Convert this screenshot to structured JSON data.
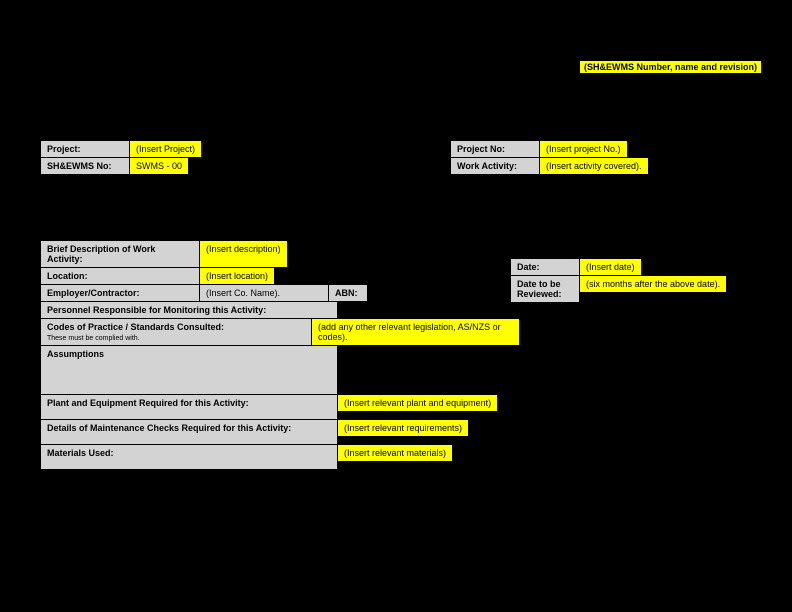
{
  "header": {
    "revision_placeholder": "(SH&EWMS Number, name and revision)"
  },
  "top_left": {
    "project_label": "Project:",
    "project_value": "(Insert Project)",
    "shewms_no_label": "SH&EWMS No:",
    "shewms_no_value": "SWMS - 00"
  },
  "top_right": {
    "project_no_label": "Project No:",
    "project_no_value": "(Insert project No.)",
    "work_activity_label": "Work Activity:",
    "work_activity_value": "(Insert activity covered)."
  },
  "details": {
    "brief_desc_label": "Brief Description of Work Activity:",
    "brief_desc_value": "(Insert description)",
    "location_label": "Location:",
    "location_value": "(Insert location)",
    "employer_label": "Employer/Contractor:",
    "employer_value": "(Insert Co. Name).",
    "abn_label": "ABN:",
    "personnel_label": "Personnel Responsible for Monitoring this Activity:",
    "codes_label": "Codes of Practice / Standards Consulted:",
    "codes_subtext": "These must be complied with.",
    "codes_value": "(add any other relevant legislation, AS/NZS or codes).",
    "assumptions_label": "Assumptions",
    "plant_label": "Plant and Equipment Required for this Activity:",
    "plant_value": "(Insert relevant plant and equipment)",
    "maintenance_label": "Details of Maintenance Checks Required for this Activity:",
    "maintenance_value": "(Insert relevant requirements)",
    "materials_label": "Materials Used:",
    "materials_value": "(Insert relevant materials)"
  },
  "right_details": {
    "date_label": "Date:",
    "date_value": "(Insert date)",
    "review_label": "Date to be Reviewed:",
    "review_value": "(six months after the above date)."
  }
}
